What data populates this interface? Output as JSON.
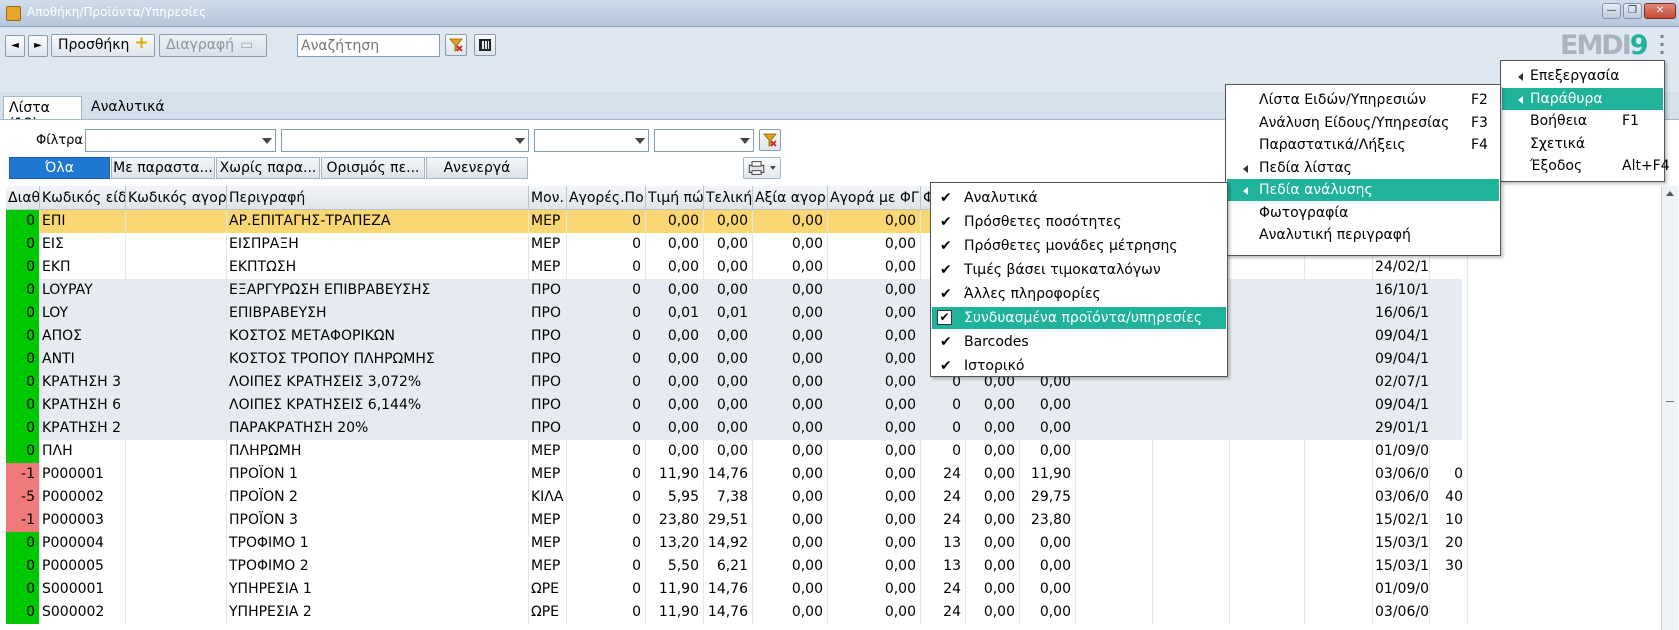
{
  "window": {
    "title": "Αποθήκη/Προϊόντα/Υπηρεσίες"
  },
  "toolbar": {
    "prev_label": "◄",
    "next_label": "►",
    "add_label": "Προσθήκη",
    "delete_label": "Διαγραφή",
    "search_placeholder": "Αναζήτηση",
    "logo_text": "EMDI",
    "logo_number": "9"
  },
  "tabs": [
    {
      "label": "Λίστα (18)"
    },
    {
      "label": "Αναλυτικά"
    }
  ],
  "filters": {
    "label": "Φίλτρα"
  },
  "segments": [
    "Όλα",
    "Με παραστα...",
    "Χωρίς παρα...",
    "Ορισμός πε...",
    "Ανενεργά"
  ],
  "columns": [
    "Διαθ",
    "Κωδικός είδ",
    "Κωδικός αγορ",
    "Περιγραφή",
    "Μον.",
    "Αγορές.Πο",
    "Τιμή πώ",
    "Τελική",
    "Αξία αγορ",
    "Αγορά με ΦΓ",
    "Φ"
  ],
  "rows": [
    {
      "avail": "0",
      "code": "ΕΠΙ",
      "buycode": "",
      "desc": "ΑΡ.ΕΠΙΤΑΓΗΣ-ΤΡΑΠΕΖΑ",
      "unit": "ΜΕΡ",
      "qty": "0",
      "price": "0,00",
      "final": "0,00",
      "value": "0,00",
      "buyfpa": "0,00",
      "c11": "",
      "c12": "",
      "c13": "",
      "date": "",
      "extra": "",
      "status": "g",
      "style": "hl"
    },
    {
      "avail": "0",
      "code": "ΕΙΣ",
      "buycode": "",
      "desc": "ΕΙΣΠΡΑΞΗ",
      "unit": "ΜΕΡ",
      "qty": "0",
      "price": "0,00",
      "final": "0,00",
      "value": "0,00",
      "buyfpa": "0,00",
      "c11": "",
      "c12": "",
      "c13": "",
      "date": "",
      "extra": "",
      "status": "g",
      "style": ""
    },
    {
      "avail": "0",
      "code": "ΕΚΠ",
      "buycode": "",
      "desc": "ΕΚΠΤΩΣΗ",
      "unit": "ΜΕΡ",
      "qty": "0",
      "price": "0,00",
      "final": "0,00",
      "value": "0,00",
      "buyfpa": "0,00",
      "c11": "",
      "c12": "",
      "c13": "",
      "date": "24/02/1",
      "extra": "",
      "status": "g",
      "style": ""
    },
    {
      "avail": "0",
      "code": "LOYPAY",
      "buycode": "",
      "desc": "ΕΞΑΡΓΥΡΩΣΗ ΕΠΙΒΡΑΒΕΥΣΗΣ",
      "unit": "ΠΡΟ",
      "qty": "0",
      "price": "0,00",
      "final": "0,00",
      "value": "0,00",
      "buyfpa": "0,00",
      "c11": "",
      "c12": "",
      "c13": "",
      "date": "16/10/1",
      "extra": "",
      "status": "g",
      "style": "grey"
    },
    {
      "avail": "0",
      "code": "LOY",
      "buycode": "",
      "desc": "ΕΠΙΒΡΑΒΕΥΣΗ",
      "unit": "ΠΡΟ",
      "qty": "0",
      "price": "0,01",
      "final": "0,01",
      "value": "0,00",
      "buyfpa": "0,00",
      "c11": "",
      "c12": "",
      "c13": "",
      "date": "16/06/1",
      "extra": "",
      "status": "g",
      "style": "grey"
    },
    {
      "avail": "0",
      "code": "ΑΠΟΣ",
      "buycode": "",
      "desc": "ΚΟΣΤΟΣ ΜΕΤΑΦΟΡΙΚΩΝ",
      "unit": "ΠΡΟ",
      "qty": "0",
      "price": "0,00",
      "final": "0,00",
      "value": "0,00",
      "buyfpa": "0,00",
      "c11": "",
      "c12": "",
      "c13": "",
      "date": "09/04/1",
      "extra": "",
      "status": "g",
      "style": "grey"
    },
    {
      "avail": "0",
      "code": "ΑΝΤΙ",
      "buycode": "",
      "desc": "ΚΟΣΤΟΣ ΤΡΟΠΟΥ ΠΛΗΡΩΜΗΣ",
      "unit": "ΠΡΟ",
      "qty": "0",
      "price": "0,00",
      "final": "0,00",
      "value": "0,00",
      "buyfpa": "0,00",
      "c11": "",
      "c12": "",
      "c13": "",
      "date": "09/04/1",
      "extra": "",
      "status": "g",
      "style": "grey"
    },
    {
      "avail": "0",
      "code": "ΚΡΑΤΗΣΗ 3",
      "buycode": "",
      "desc": "ΛΟΙΠΕΣ ΚΡΑΤΗΣΕΙΣ 3,072%",
      "unit": "ΠΡΟ",
      "qty": "0",
      "price": "0,00",
      "final": "0,00",
      "value": "0,00",
      "buyfpa": "0,00",
      "c11": "0",
      "c12": "0,00",
      "c13": "0,00",
      "date": "02/07/1",
      "extra": "",
      "status": "g",
      "style": "grey"
    },
    {
      "avail": "0",
      "code": "ΚΡΑΤΗΣΗ 6",
      "buycode": "",
      "desc": "ΛΟΙΠΕΣ ΚΡΑΤΗΣΕΙΣ 6,144%",
      "unit": "ΠΡΟ",
      "qty": "0",
      "price": "0,00",
      "final": "0,00",
      "value": "0,00",
      "buyfpa": "0,00",
      "c11": "0",
      "c12": "0,00",
      "c13": "0,00",
      "date": "09/04/1",
      "extra": "",
      "status": "g",
      "style": "grey"
    },
    {
      "avail": "0",
      "code": "ΚΡΑΤΗΣΗ 2",
      "buycode": "",
      "desc": "ΠΑΡΑΚΡΑΤΗΣΗ 20%",
      "unit": "ΠΡΟ",
      "qty": "0",
      "price": "0,00",
      "final": "0,00",
      "value": "0,00",
      "buyfpa": "0,00",
      "c11": "0",
      "c12": "0,00",
      "c13": "0,00",
      "date": "29/01/1",
      "extra": "",
      "status": "g",
      "style": "grey"
    },
    {
      "avail": "0",
      "code": "ΠΛΗ",
      "buycode": "",
      "desc": "ΠΛΗΡΩΜΗ",
      "unit": "ΜΕΡ",
      "qty": "0",
      "price": "0,00",
      "final": "0,00",
      "value": "0,00",
      "buyfpa": "0,00",
      "c11": "0",
      "c12": "0,00",
      "c13": "0,00",
      "date": "01/09/0",
      "extra": "",
      "status": "g",
      "style": ""
    },
    {
      "avail": "-1",
      "code": "P000001",
      "buycode": "",
      "desc": "ΠΡΟΪΟΝ 1",
      "unit": "ΜΕΡ",
      "qty": "0",
      "price": "11,90",
      "final": "14,76",
      "value": "0,00",
      "buyfpa": "0,00",
      "c11": "24",
      "c12": "0,00",
      "c13": "11,90",
      "date": "03/06/0",
      "extra": "0",
      "status": "r",
      "style": ""
    },
    {
      "avail": "-5",
      "code": "P000002",
      "buycode": "",
      "desc": "ΠΡΟΪΟΝ 2",
      "unit": "ΚΙΛΑ",
      "qty": "0",
      "price": "5,95",
      "final": "7,38",
      "value": "0,00",
      "buyfpa": "0,00",
      "c11": "24",
      "c12": "0,00",
      "c13": "29,75",
      "date": "03/06/0",
      "extra": "40",
      "status": "r",
      "style": ""
    },
    {
      "avail": "-1",
      "code": "P000003",
      "buycode": "",
      "desc": "ΠΡΟΪΟΝ 3",
      "unit": "ΜΕΡ",
      "qty": "0",
      "price": "23,80",
      "final": "29,51",
      "value": "0,00",
      "buyfpa": "0,00",
      "c11": "24",
      "c12": "0,00",
      "c13": "23,80",
      "date": "15/02/1",
      "extra": "10",
      "status": "r",
      "style": ""
    },
    {
      "avail": "0",
      "code": "P000004",
      "buycode": "",
      "desc": "ΤΡΟΦΙΜΟ 1",
      "unit": "ΜΕΡ",
      "qty": "0",
      "price": "13,20",
      "final": "14,92",
      "value": "0,00",
      "buyfpa": "0,00",
      "c11": "13",
      "c12": "0,00",
      "c13": "0,00",
      "date": "15/03/1",
      "extra": "20",
      "status": "g",
      "style": ""
    },
    {
      "avail": "0",
      "code": "P000005",
      "buycode": "",
      "desc": "ΤΡΟΦΙΜΟ 2",
      "unit": "ΜΕΡ",
      "qty": "0",
      "price": "5,50",
      "final": "6,21",
      "value": "0,00",
      "buyfpa": "0,00",
      "c11": "13",
      "c12": "0,00",
      "c13": "0,00",
      "date": "15/03/1",
      "extra": "30",
      "status": "g",
      "style": ""
    },
    {
      "avail": "0",
      "code": "S000001",
      "buycode": "",
      "desc": "ΥΠΗΡΕΣΙΑ 1",
      "unit": "ΩΡΕ",
      "qty": "0",
      "price": "11,90",
      "final": "14,76",
      "value": "0,00",
      "buyfpa": "0,00",
      "c11": "24",
      "c12": "0,00",
      "c13": "0,00",
      "date": "01/09/0",
      "extra": "",
      "status": "g",
      "style": ""
    },
    {
      "avail": "0",
      "code": "S000002",
      "buycode": "",
      "desc": "ΥΠΗΡΕΣΙΑ 2",
      "unit": "ΩΡΕ",
      "qty": "0",
      "price": "11,90",
      "final": "14,76",
      "value": "0,00",
      "buyfpa": "0,00",
      "c11": "24",
      "c12": "0,00",
      "c13": "0,00",
      "date": "03/06/0",
      "extra": "",
      "status": "g",
      "style": ""
    }
  ],
  "main_menu": [
    {
      "label": "Επεξεργασία",
      "key": "",
      "submenu": true
    },
    {
      "label": "Παράθυρα",
      "key": "",
      "submenu": true,
      "selected": true
    },
    {
      "label": "Βοήθεια",
      "key": "F1",
      "submenu": false
    },
    {
      "label": "Σχετικά",
      "key": "",
      "submenu": false
    },
    {
      "label": "Έξοδος",
      "key": "Alt+F4",
      "submenu": false
    }
  ],
  "windows_menu": [
    {
      "label": "Λίστα Ειδών/Υπηρεσιών",
      "key": "F2",
      "submenu": false
    },
    {
      "label": "Ανάλυση  Είδους/Υπηρεσίας",
      "key": "F3",
      "submenu": false
    },
    {
      "label": "Παραστατικά/Λήξεις",
      "key": "F4",
      "submenu": false
    },
    {
      "label": "Πεδία λίστας",
      "key": "",
      "submenu": true
    },
    {
      "label": "Πεδία ανάλυσης",
      "key": "",
      "submenu": true,
      "selected": true
    },
    {
      "label": "Φωτογραφία",
      "key": "",
      "submenu": false
    },
    {
      "label": "Αναλυτική περιγραφή",
      "key": "",
      "submenu": false
    }
  ],
  "analysis_menu": [
    {
      "label": "Αναλυτικά",
      "checked": true
    },
    {
      "label": "Πρόσθετες ποσότητες",
      "checked": true
    },
    {
      "label": "Πρόσθετες μονάδες μέτρησης",
      "checked": true
    },
    {
      "label": "Τιμές βάσει τιμοκαταλόγων",
      "checked": true
    },
    {
      "label": "Άλλες πληροφορίες",
      "checked": true
    },
    {
      "label": "Συνδυασμένα προϊόντα/υπηρεσίες",
      "checked": true,
      "selected": true
    },
    {
      "label": "Barcodes",
      "checked": true
    },
    {
      "label": "Ιστορικό",
      "checked": true
    }
  ]
}
